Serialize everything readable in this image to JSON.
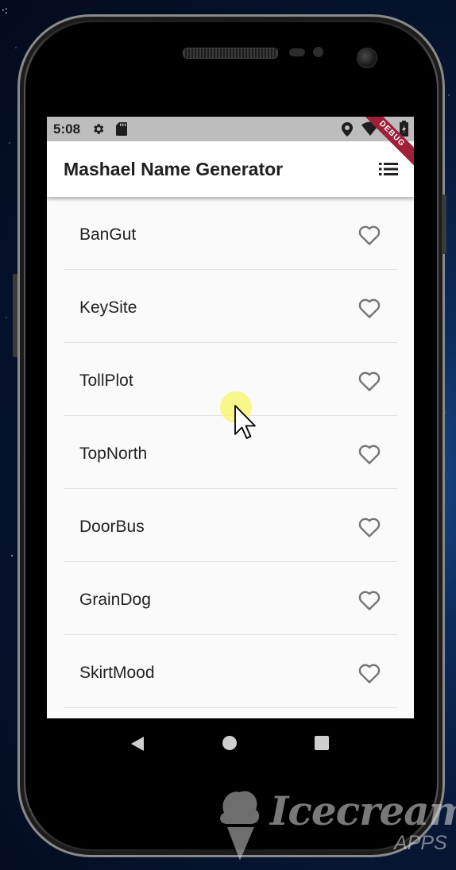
{
  "status_bar": {
    "time": "5:08",
    "icons_left": [
      "gear-icon",
      "sd-card-icon"
    ],
    "icons_right": [
      "location-icon",
      "wifi-icon",
      "battery-icon"
    ]
  },
  "debug_banner": "DEBUG",
  "app_bar": {
    "title": "Mashael Name Generator",
    "action_icon": "list-icon"
  },
  "list": {
    "items": [
      {
        "name": "BanGut",
        "favorite": false
      },
      {
        "name": "KeySite",
        "favorite": false
      },
      {
        "name": "TollPlot",
        "favorite": false
      },
      {
        "name": "TopNorth",
        "favorite": false
      },
      {
        "name": "DoorBus",
        "favorite": false
      },
      {
        "name": "GrainDog",
        "favorite": false
      },
      {
        "name": "SkirtMood",
        "favorite": false
      }
    ]
  },
  "nav_bar": {
    "buttons": [
      "back-icon",
      "home-icon",
      "recents-icon"
    ]
  },
  "watermark": {
    "brand": "Icecream",
    "sub": "APPS"
  },
  "colors": {
    "app_bar_bg": "#ffffff",
    "status_bar_bg": "#bdbdbd",
    "list_bg": "#fafafa",
    "debug_banner": "#a0203a",
    "touch_indicator": "#f8f478"
  }
}
